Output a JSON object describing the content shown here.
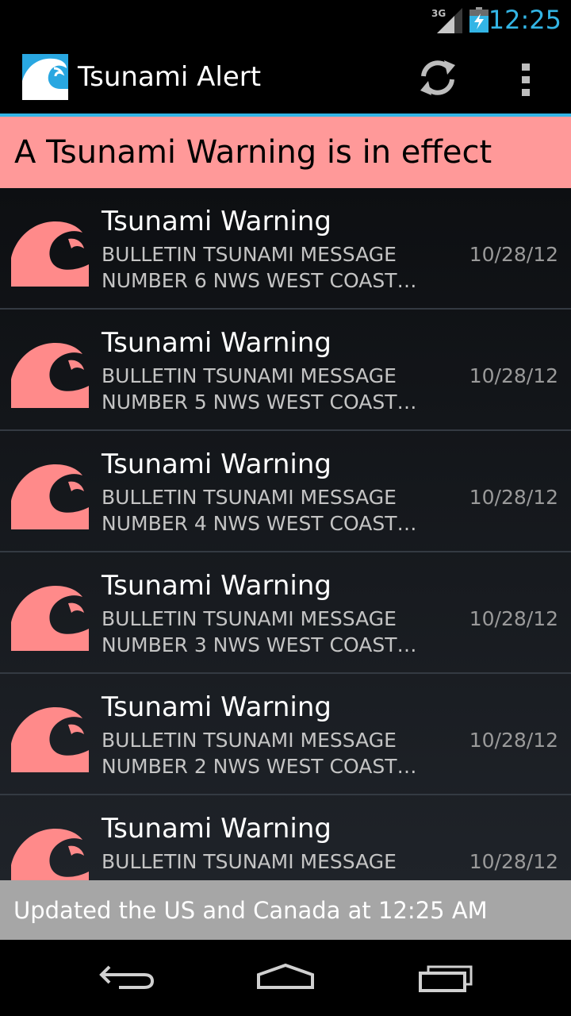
{
  "status_bar": {
    "network_label": "3G",
    "time": "12:25",
    "icons": [
      "signal-3g-icon",
      "battery-charging-icon"
    ],
    "accent_color": "#33b5e5"
  },
  "action_bar": {
    "title": "Tsunami Alert",
    "icons": [
      "tsunami-logo-icon",
      "refresh-icon",
      "overflow-menu-icon"
    ]
  },
  "banner": {
    "text": "A Tsunami Warning is in effect",
    "color": "#ff9999"
  },
  "alerts": [
    {
      "title": "Tsunami Warning",
      "line1": "BULLETIN TSUNAMI MESSAGE",
      "line2": "NUMBER 6 NWS WEST COAST…",
      "date": "10/28/12"
    },
    {
      "title": "Tsunami Warning",
      "line1": "BULLETIN TSUNAMI MESSAGE",
      "line2": "NUMBER 5 NWS WEST COAST…",
      "date": "10/28/12"
    },
    {
      "title": "Tsunami Warning",
      "line1": "BULLETIN TSUNAMI MESSAGE",
      "line2": "NUMBER 4 NWS WEST COAST…",
      "date": "10/28/12"
    },
    {
      "title": "Tsunami Warning",
      "line1": "BULLETIN TSUNAMI MESSAGE",
      "line2": "NUMBER 3 NWS WEST COAST…",
      "date": "10/28/12"
    },
    {
      "title": "Tsunami Warning",
      "line1": "BULLETIN TSUNAMI MESSAGE",
      "line2": "NUMBER 2 NWS WEST COAST…",
      "date": "10/28/12"
    },
    {
      "title": "Tsunami Warning",
      "line1": "BULLETIN TSUNAMI MESSAGE",
      "line2": "",
      "date": "10/28/12"
    }
  ],
  "wave_icon_color": "#ff8a8a",
  "footer": {
    "update_text": "Updated the US and Canada at 12:25 AM"
  },
  "nav_bar": {
    "icons": [
      "back-icon",
      "home-icon",
      "recent-apps-icon"
    ]
  }
}
